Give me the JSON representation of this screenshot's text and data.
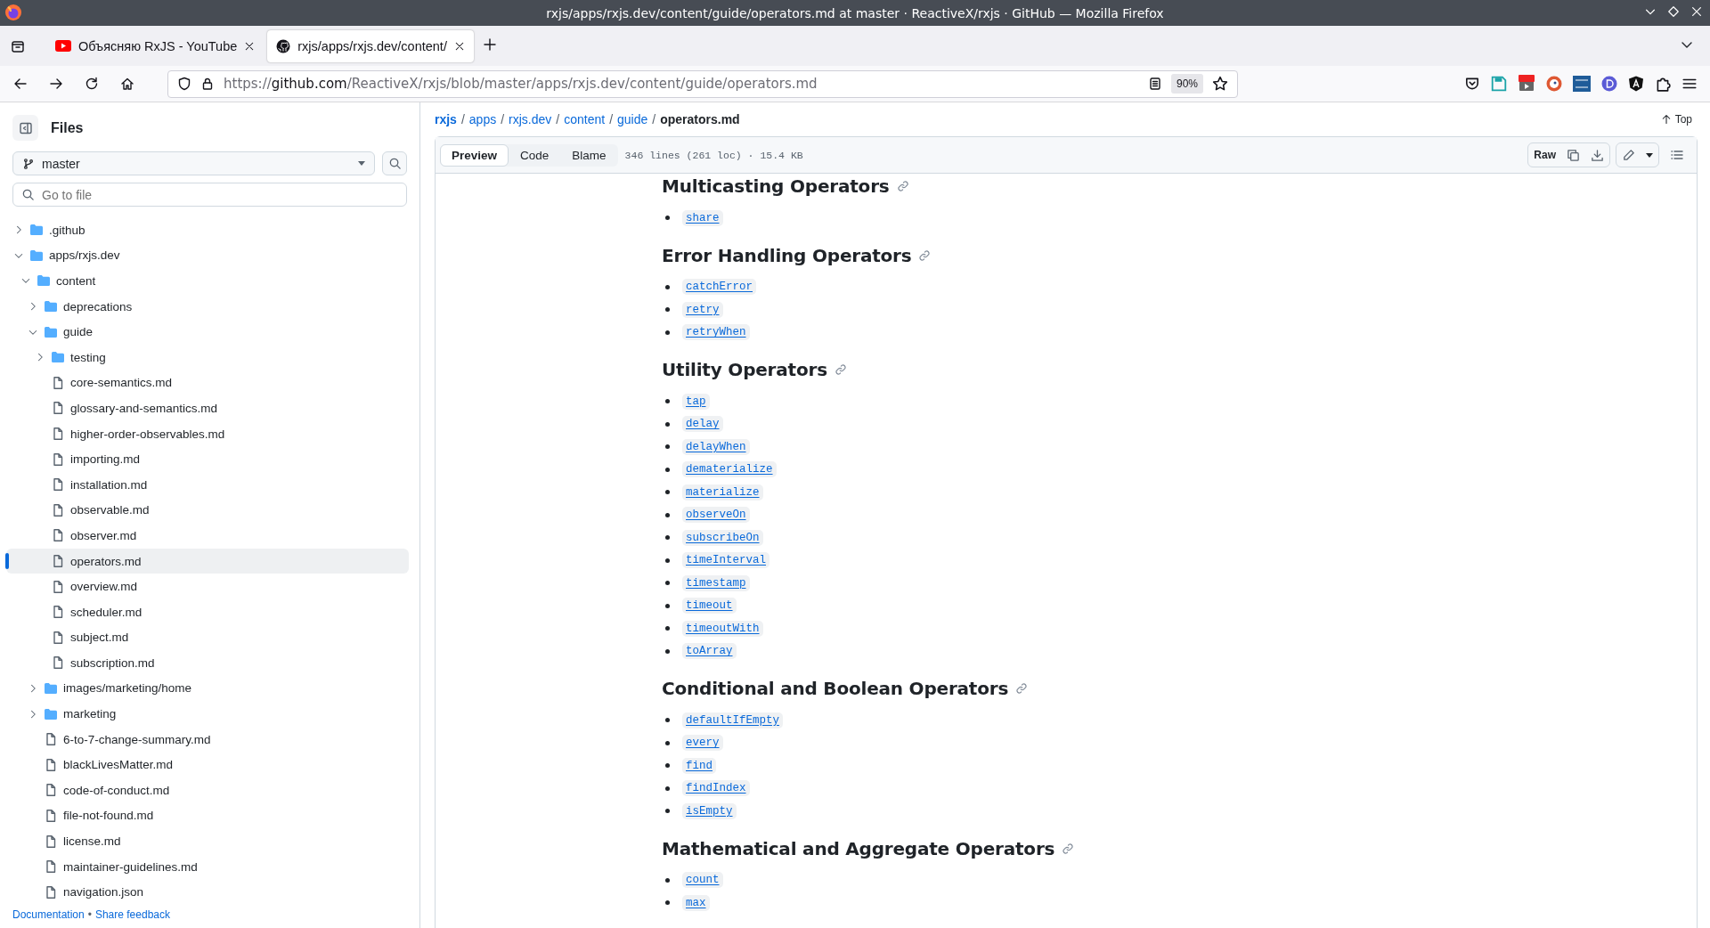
{
  "window": {
    "title": "rxjs/apps/rxjs.dev/content/guide/operators.md at master · ReactiveX/rxjs · GitHub — Mozilla Firefox"
  },
  "tabs": [
    {
      "title": "Объясняю RxJS - YouTube",
      "kind": "youtube",
      "selected": false
    },
    {
      "title": "rxjs/apps/rxjs.dev/content/",
      "kind": "github",
      "selected": true
    }
  ],
  "address_bar": {
    "scheme": "https://",
    "host": "github.com",
    "path": "/ReactiveX/rxjs/blob/master/apps/rxjs.dev/content/guide/operators.md",
    "zoom": "90%"
  },
  "sidebar": {
    "title": "Files",
    "branch": "master",
    "search": {
      "placeholder": "Go to file"
    },
    "tree": [
      {
        "name": ".github",
        "kind": "folder",
        "expanded": false,
        "selected": false
      },
      {
        "name": "apps/rxjs.dev",
        "kind": "folder",
        "expanded": true,
        "selected": false,
        "children": [
          {
            "name": "content",
            "kind": "folder",
            "expanded": true,
            "selected": false,
            "children": [
              {
                "name": "deprecations",
                "kind": "folder",
                "expanded": false,
                "selected": false
              },
              {
                "name": "guide",
                "kind": "folder",
                "expanded": true,
                "selected": false,
                "children": [
                  {
                    "name": "testing",
                    "kind": "folder",
                    "expanded": false,
                    "selected": false
                  },
                  {
                    "name": "core-semantics.md",
                    "kind": "file",
                    "selected": false
                  },
                  {
                    "name": "glossary-and-semantics.md",
                    "kind": "file",
                    "selected": false
                  },
                  {
                    "name": "higher-order-observables.md",
                    "kind": "file",
                    "selected": false
                  },
                  {
                    "name": "importing.md",
                    "kind": "file",
                    "selected": false
                  },
                  {
                    "name": "installation.md",
                    "kind": "file",
                    "selected": false
                  },
                  {
                    "name": "observable.md",
                    "kind": "file",
                    "selected": false
                  },
                  {
                    "name": "observer.md",
                    "kind": "file",
                    "selected": false
                  },
                  {
                    "name": "operators.md",
                    "kind": "file",
                    "selected": true
                  },
                  {
                    "name": "overview.md",
                    "kind": "file",
                    "selected": false
                  },
                  {
                    "name": "scheduler.md",
                    "kind": "file",
                    "selected": false
                  },
                  {
                    "name": "subject.md",
                    "kind": "file",
                    "selected": false
                  },
                  {
                    "name": "subscription.md",
                    "kind": "file",
                    "selected": false
                  }
                ]
              },
              {
                "name": "images/marketing/home",
                "kind": "folder",
                "expanded": false,
                "selected": false
              },
              {
                "name": "marketing",
                "kind": "folder",
                "expanded": false,
                "selected": false
              },
              {
                "name": "6-to-7-change-summary.md",
                "kind": "file",
                "selected": false
              },
              {
                "name": "blackLivesMatter.md",
                "kind": "file",
                "selected": false
              },
              {
                "name": "code-of-conduct.md",
                "kind": "file",
                "selected": false
              },
              {
                "name": "file-not-found.md",
                "kind": "file",
                "selected": false
              },
              {
                "name": "license.md",
                "kind": "file",
                "selected": false
              },
              {
                "name": "maintainer-guidelines.md",
                "kind": "file",
                "selected": false
              },
              {
                "name": "navigation.json",
                "kind": "file",
                "selected": false
              }
            ]
          }
        ]
      }
    ],
    "footer": {
      "links": [
        "Documentation",
        "Share feedback"
      ],
      "separator": "•"
    }
  },
  "file_header": {
    "breadcrumb": [
      "rxjs",
      "apps",
      "rxjs.dev",
      "content",
      "guide"
    ],
    "current": "operators.md",
    "separator": "/",
    "top": "Top",
    "tabs": [
      {
        "label": "Preview",
        "selected": true
      },
      {
        "label": "Code",
        "selected": false
      },
      {
        "label": "Blame",
        "selected": false
      }
    ],
    "info": "346 lines (261 loc) · 15.4 KB",
    "raw": "Raw"
  },
  "content": {
    "sections": [
      {
        "heading": "Multicasting Operators",
        "items": [
          "share"
        ]
      },
      {
        "heading": "Error Handling Operators",
        "items": [
          "catchError",
          "retry",
          "retryWhen"
        ]
      },
      {
        "heading": "Utility Operators",
        "items": [
          "tap",
          "delay",
          "delayWhen",
          "dematerialize",
          "materialize",
          "observeOn",
          "subscribeOn",
          "timeInterval",
          "timestamp",
          "timeout",
          "timeoutWith",
          "toArray"
        ]
      },
      {
        "heading": "Conditional and Boolean Operators",
        "items": [
          "defaultIfEmpty",
          "every",
          "find",
          "findIndex",
          "isEmpty"
        ]
      },
      {
        "heading": "Mathematical and Aggregate Operators",
        "items": [
          "count",
          "max"
        ]
      }
    ]
  }
}
